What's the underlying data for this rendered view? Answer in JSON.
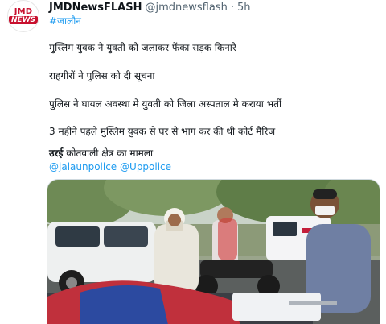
{
  "author": {
    "display_name": "JMDNewsFLASH",
    "handle": "@jmdnewsflash",
    "separator": "·",
    "time": "5h",
    "avatar_logo_text": "JMD",
    "avatar_logo_sub": "NEWS"
  },
  "tweet": {
    "hashtag": "#जालौन",
    "lines": [
      "मुस्लिम युवक ने युवती को जलाकर फेंका सड़क किनारे",
      "राहगीरों ने पुलिस को दी सूचना",
      "पुलिस ने घायल अवस्था मे युवती को जिला अस्पताल मे कराया भर्ती",
      "3 महीने पहले मुस्लिम युवक से घर से भाग कर की थी कोर्ट मैरिज"
    ],
    "location_bold": "उरई",
    "location_rest": " कोतवाली क्षेत्र का मामला",
    "mentions": [
      "@jalaunpolice",
      "@Uppolice"
    ]
  },
  "media": {
    "type": "photo",
    "alt": "Street scene with a white car, people on a motorbike, and a covered person on a stretcher"
  },
  "colors": {
    "link": "#1d9bf0",
    "text": "#0f1419",
    "muted": "#536471",
    "brand_red": "#c8102e"
  }
}
